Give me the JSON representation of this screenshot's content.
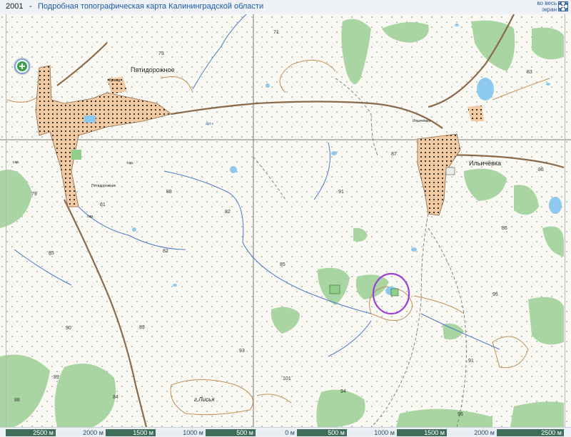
{
  "header": {
    "year": "2001",
    "separator": "-",
    "title": "Подробная топографическая карта Калининградской области",
    "fullscreen_line1": "во весь",
    "fullscreen_line2": "экран"
  },
  "map": {
    "settlements": [
      {
        "name": "Пятидорожное"
      },
      {
        "name": "Ильичёвка"
      },
      {
        "name": "Ильичёвка"
      },
      {
        "name": "Пятидорожное"
      }
    ],
    "features": {
      "hill": "г.Лисья",
      "brd": "бр.вод",
      "sar1": "сар.",
      "sar2": "сар.",
      "sar3": "сар.",
      "arteska": "арт.к"
    },
    "elevations": [
      "79",
      "71",
      "83",
      "87",
      "91",
      "86",
      "79",
      "81",
      "88",
      "82",
      "82",
      "85",
      "85",
      "86",
      "95",
      "90",
      "83",
      "93",
      "91",
      "89",
      "84",
      "101",
      "94",
      "96",
      "88"
    ],
    "highlight": {
      "shape": "circle",
      "color": "#9b3fd8"
    },
    "colors": {
      "forest": "#a8d5a2",
      "settlement": "#f2c9a0",
      "water": "#8ec9ef",
      "road": "#8a6a4a",
      "contour": "#c0905a",
      "grid": "#555555"
    }
  },
  "scale": {
    "labels": [
      "2500 м",
      "2000 м",
      "1500 м",
      "1000 м",
      "500 м",
      "0 м",
      "500 м",
      "1000 м",
      "1500 м",
      "2000 м",
      "2500 м"
    ]
  }
}
